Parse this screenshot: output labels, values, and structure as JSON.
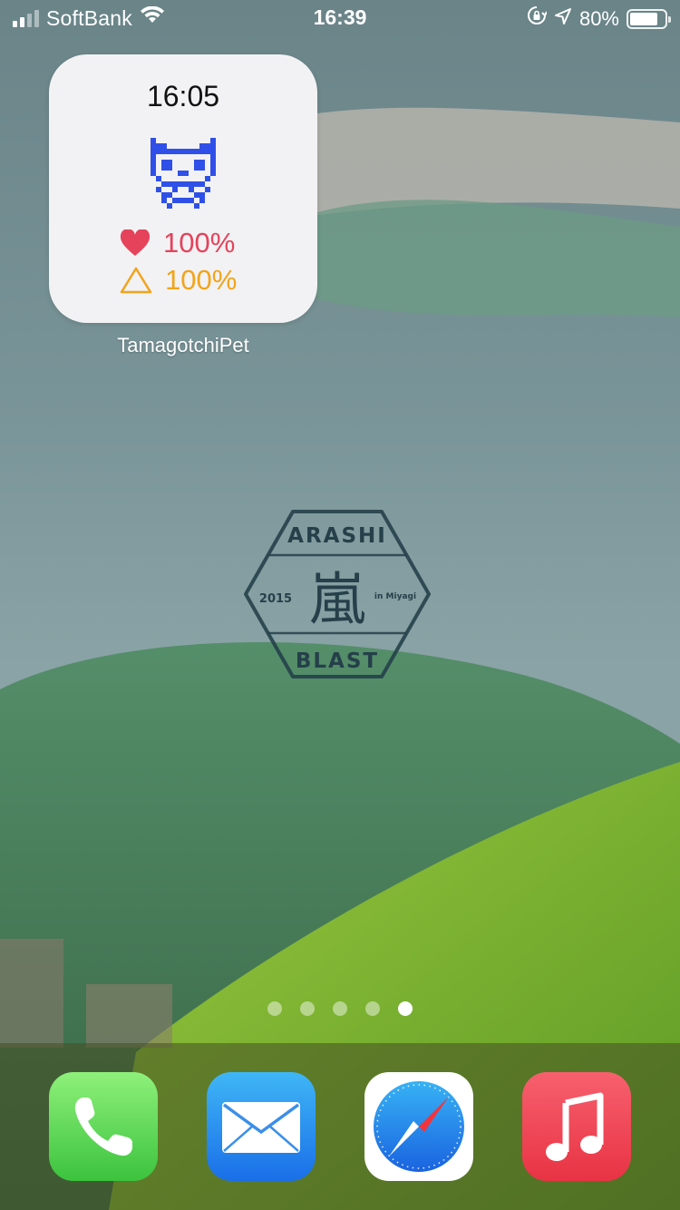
{
  "status_bar": {
    "carrier": "SoftBank",
    "time": "16:39",
    "battery_percent": "80%",
    "battery_level": 0.8,
    "icons": [
      "signal-icon",
      "wifi-icon",
      "orientation-lock-icon",
      "location-icon",
      "battery-icon"
    ]
  },
  "widget": {
    "time": "16:05",
    "hunger": "100%",
    "happiness": "100%",
    "label": "TamagotchiPet",
    "colors": {
      "hunger": "#e5435b",
      "happiness": "#f1a41b",
      "pet": "#2f50e8"
    }
  },
  "stamp": {
    "top_text": "ARASHI",
    "bottom_text": "BLAST",
    "year": "2015",
    "location": "in Miyagi",
    "kanji": "嵐"
  },
  "page_indicator": {
    "pages": 5,
    "current": 5
  },
  "dock": {
    "apps": [
      {
        "name": "Phone",
        "icon": "phone-icon"
      },
      {
        "name": "Mail",
        "icon": "mail-icon"
      },
      {
        "name": "Safari",
        "icon": "compass-icon"
      },
      {
        "name": "Music",
        "icon": "music-note-icon"
      }
    ]
  }
}
